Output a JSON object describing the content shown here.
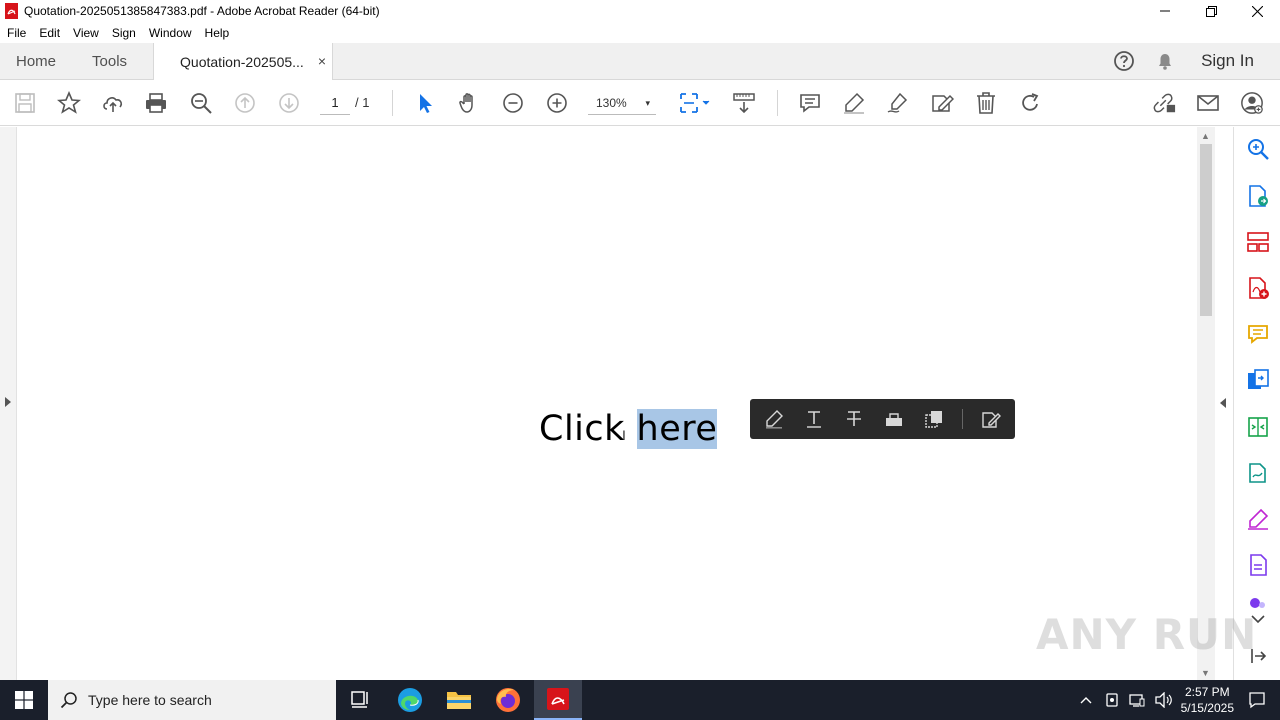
{
  "window": {
    "title": "Quotation-2025051385847383.pdf - Adobe Acrobat Reader (64-bit)"
  },
  "menu": [
    "File",
    "Edit",
    "View",
    "Sign",
    "Window",
    "Help"
  ],
  "tabs": {
    "home": "Home",
    "tools": "Tools",
    "document": "Quotation-202505...",
    "close": "×",
    "sign_in": "Sign In"
  },
  "toolbar": {
    "page_current": "1",
    "page_total": "/ 1",
    "zoom": "130%",
    "zoom_caret": "▾"
  },
  "document": {
    "text_before": "Click ",
    "text_selected": "here",
    "cursor": "I"
  },
  "watermark": "ANY RUN",
  "taskbar": {
    "search_placeholder": "Type here to search",
    "time": "2:57 PM",
    "date": "5/15/2025"
  },
  "colors": {
    "acrobat_red": "#d7141a",
    "toolbar_accent": "#1473e6",
    "selection": "#a8c6e6",
    "taskbar": "#1a1f2b"
  }
}
